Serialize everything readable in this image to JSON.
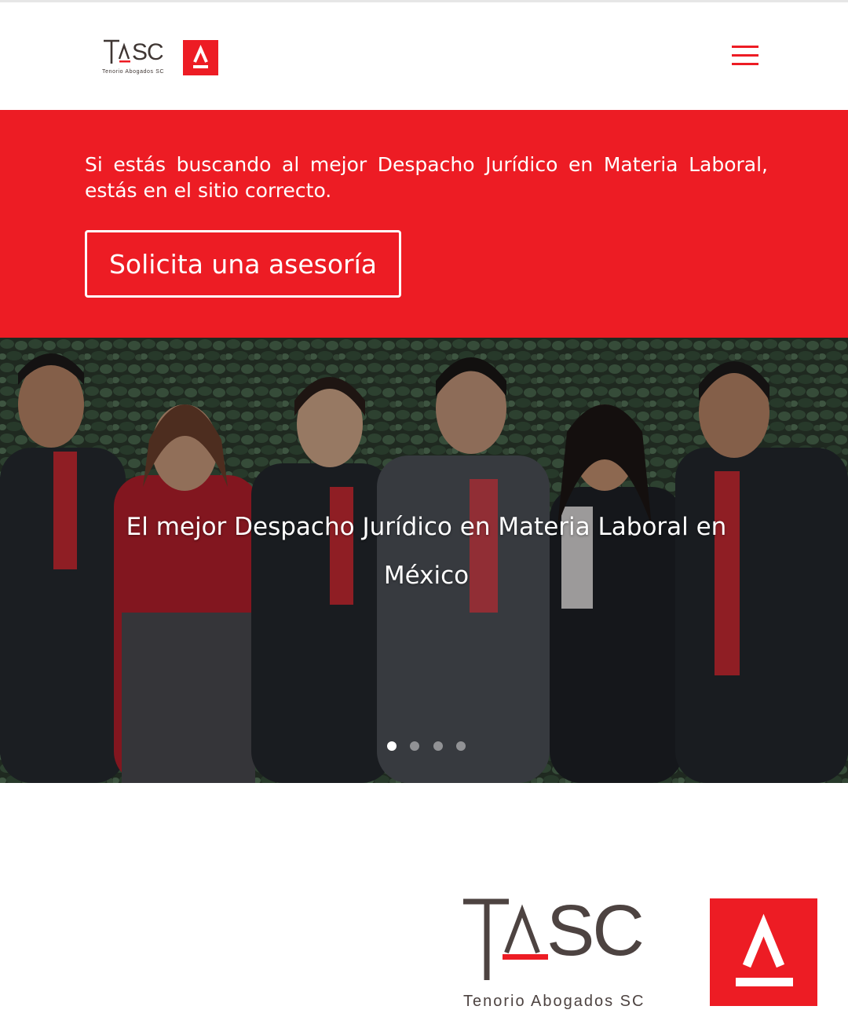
{
  "header": {
    "logo": {
      "wordmark": "TASC",
      "tagline": "Tenorio Abogados SC",
      "mark_letter": "A"
    },
    "menu_icon": "hamburger-menu-icon"
  },
  "hero": {
    "intro_text": "Si estás buscando al mejor Despacho Jurídico en Materia Laboral, estás en el sitio correcto.",
    "cta_label": "Solicita una asesoría"
  },
  "slider": {
    "caption": "El mejor Despacho Jurídico en Materia Laboral en México",
    "slide_count": 4,
    "active_slide": 1
  },
  "footer_logo": {
    "wordmark": "TASC",
    "tagline": "Tenorio Abogados SC",
    "mark_letter": "A"
  },
  "colors": {
    "brand_red": "#ed1c24",
    "logo_gray": "#4d4341",
    "white": "#ffffff"
  }
}
